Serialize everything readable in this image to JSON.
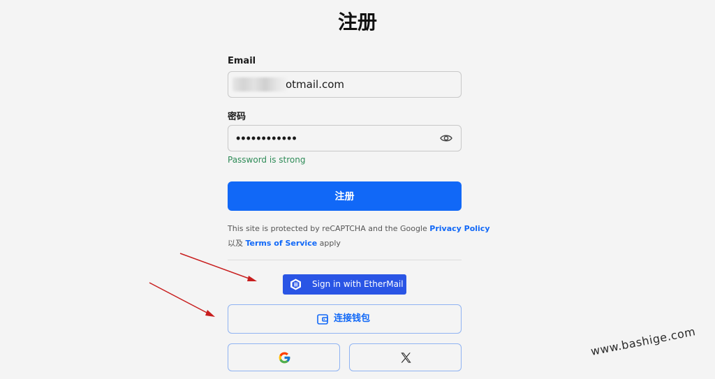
{
  "page": {
    "title": "注册"
  },
  "form": {
    "email_label": "Email",
    "email_value": "otmail.com",
    "password_label": "密码",
    "password_dots": "••••••••••••",
    "password_hint": "Password is strong",
    "submit_label": "注册"
  },
  "legal": {
    "line1_prefix": "This site is protected by reCAPTCHA and the Google ",
    "privacy_link": "Privacy Policy",
    "line2_prefix": "以及 ",
    "terms_link": "Terms of Service",
    "line2_suffix": " apply"
  },
  "auth": {
    "ethermail_label": "Sign in with EtherMail",
    "wallet_label": "连接钱包"
  },
  "watermark": "www.bashige.com",
  "colors": {
    "primary": "#1168f7",
    "ethermail": "#2a55e5",
    "hint_green": "#2e8b57",
    "arrow_red": "#c81e1e"
  },
  "icons": {
    "password_toggle": "eye-icon",
    "ethermail": "ethermail-logo-icon",
    "wallet": "wallet-icon",
    "google": "google-icon",
    "x": "x-logo-icon"
  }
}
